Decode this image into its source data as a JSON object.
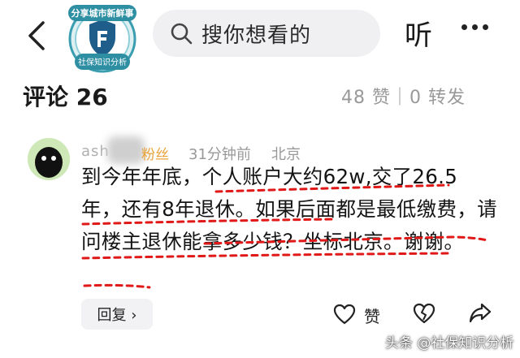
{
  "header": {
    "search_placeholder": "搜你想看的",
    "listen_label": "听",
    "logo": {
      "top_text": "分享城市新鲜事",
      "bottom_text": "社保知识分析"
    }
  },
  "comments": {
    "title": "评论 26",
    "stats": "48 赞｜0 转发"
  },
  "comment": {
    "username": "ash",
    "badge": "粉丝",
    "time": "31分钟前",
    "location": "北京",
    "body": "到今年年底，个人账户大约62w,交了26.5年，还有8年退休。如果后面都是最低缴费，请问楼主退休能拿多少钱？坐标北京。谢谢。",
    "reply_label": "回复 ›",
    "like_label": "赞"
  },
  "watermark": "头条 @社保知识分析",
  "colors": {
    "underline": "#e01818",
    "badge": "#e8a23a",
    "muted": "#999999",
    "search_bg": "#f0f0f3"
  }
}
